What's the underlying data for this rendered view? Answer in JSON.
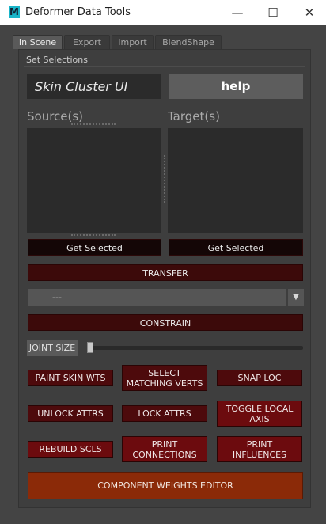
{
  "window": {
    "title": "Deformer Data Tools",
    "app_icon": "M",
    "minimize_glyph": "—",
    "maximize_glyph": "☐",
    "close_glyph": "✕"
  },
  "tabs": [
    {
      "label": "In Scene",
      "active": true
    },
    {
      "label": "Export",
      "active": false
    },
    {
      "label": "Import",
      "active": false
    },
    {
      "label": "BlendShape",
      "active": false
    }
  ],
  "set_selections": {
    "group_label": "Set Selections",
    "name_field_value": "Skin Cluster UI",
    "help_label": "help",
    "source_label": "Source(s)",
    "target_label": "Target(s)",
    "get_selected_source": "Get Selected",
    "get_selected_target": "Get Selected"
  },
  "transfer_label": "TRANSFER",
  "method_dropdown_value": "---",
  "constrain_label": "CONSTRAIN",
  "joint_size": {
    "label": "JOINT SIZE",
    "value_fraction": 0.0
  },
  "actions": {
    "paint_skin_wts": "PAINT SKIN WTS",
    "select_matching_verts": "SELECT MATCHING VERTS",
    "snap_loc": "SNAP LOC",
    "unlock_attrs": "UNLOCK  ATTRS",
    "lock_attrs": "LOCK ATTRS",
    "toggle_local_axis": "TOGGLE LOCAL AXIS",
    "rebuild_scls": "REBUILD SCLS",
    "print_connections": "PRINT CONNECTIONS",
    "print_influences": "PRINT INFLUENCES",
    "component_weights_editor": "COMPONENT WEIGHTS EDITOR"
  },
  "colors": {
    "accent_dark_red": "#4d0a0c",
    "accent_bright_red": "#6c0b0e",
    "accent_orange": "#8b2a08",
    "maya_icon": "#19b5c9"
  }
}
